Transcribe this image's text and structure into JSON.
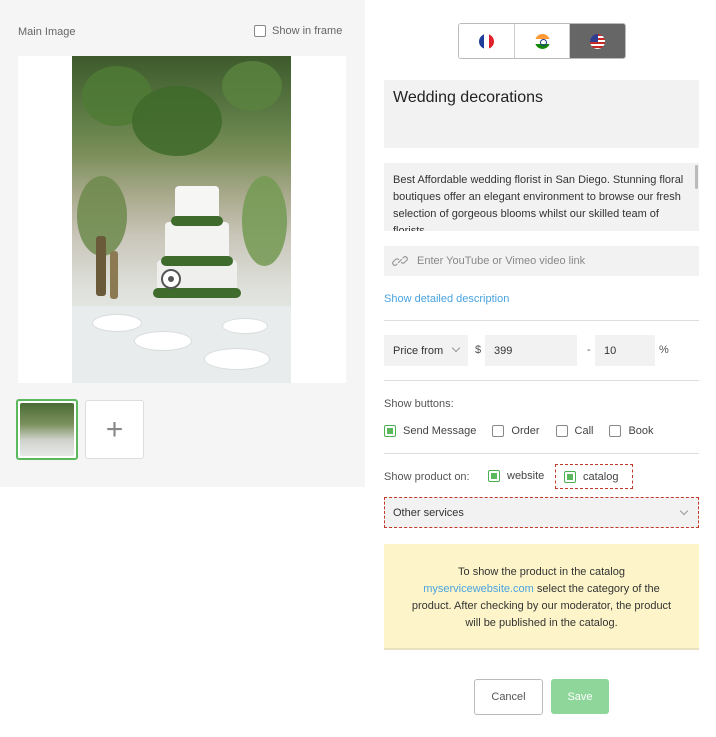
{
  "left_panel": {
    "main_image_label": "Main Image",
    "show_in_frame_label": "Show in frame",
    "show_in_frame_checked": false,
    "add_image_symbol": "+"
  },
  "languages": [
    {
      "code": "fr",
      "icon": "france-flag-icon",
      "active": false
    },
    {
      "code": "in",
      "icon": "india-flag-icon",
      "active": false
    },
    {
      "code": "us",
      "icon": "usa-flag-icon",
      "active": true
    }
  ],
  "product": {
    "title": "Wedding decorations",
    "description": "Best Affordable wedding florist in San Diego. Stunning floral boutiques offer an elegant environment to browse our fresh selection of gorgeous blooms whilst our skilled team of florists",
    "video_placeholder": "Enter YouTube or Vimeo video link",
    "detailed_description_link": "Show detailed description"
  },
  "pricing": {
    "mode": "Price from",
    "currency": "$",
    "price": "399",
    "separator": "-",
    "discount": "10",
    "percent": "%"
  },
  "show_buttons": {
    "label": "Show buttons:",
    "options": [
      {
        "label": "Send Message",
        "checked": true
      },
      {
        "label": "Order",
        "checked": false
      },
      {
        "label": "Call",
        "checked": false
      },
      {
        "label": "Book",
        "checked": false
      }
    ]
  },
  "show_product_on": {
    "label": "Show product on:",
    "website_label": "website",
    "website_checked": true,
    "catalog_label": "catalog",
    "catalog_checked": true
  },
  "category": {
    "selected": "Other services"
  },
  "notice": {
    "line_start": "To show the product in the catalog",
    "link": "myservicewebsite.com",
    "line_end": " select the category of the product. After checking by our moderator, the product will be published in the catalog."
  },
  "actions": {
    "cancel": "Cancel",
    "save": "Save"
  },
  "colors": {
    "accent_green": "#5cb85c",
    "save_button": "#8fd69a",
    "link_blue": "#4aa3df",
    "notice_bg": "#fdf5c9",
    "error_dashed": "#c0392b"
  }
}
